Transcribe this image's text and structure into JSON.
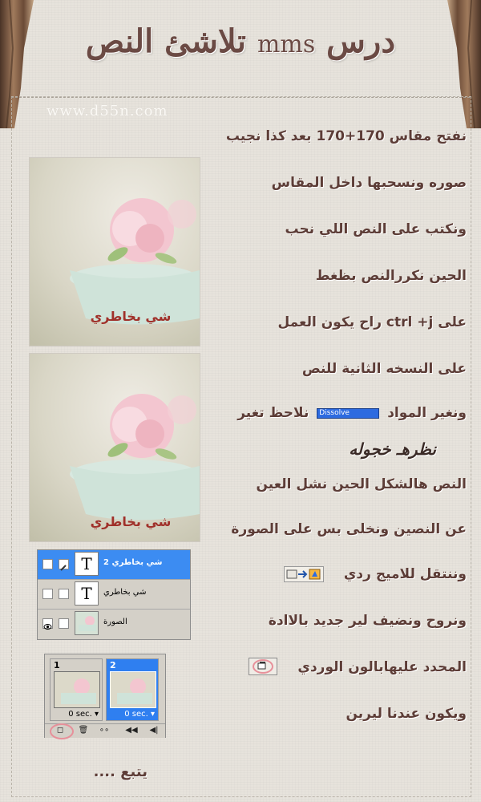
{
  "page": {
    "title_part1": "درس",
    "title_latin": "mms",
    "title_part2": "تلاشئ النص",
    "watermark": "www.d55n.com",
    "footer": "يتبع ...."
  },
  "lines": [
    {
      "text": "نفتح مقاس  170+170 بعد كذا نجيب"
    },
    {
      "text": "صوره ونسحبها داخل المقاس"
    },
    {
      "text": "ونكتب على النص اللي نحب"
    },
    {
      "text": "الحين نكررالنص بظغط"
    },
    {
      "text": "على ctrl +j راح يكون العمل"
    },
    {
      "text": "على النسخه الثانية للنص"
    },
    {
      "text_before": "ونغير المواد",
      "tag": "Dissolve",
      "text_after": "نلاحظ تغير"
    },
    {
      "text": "نظرهـ خجوله"
    },
    {
      "text": "النص هالشكل الحين نشل العين"
    },
    {
      "text": "عن النصين ونخلى بس على الصورة"
    },
    {
      "text": "وننتقل للاميج ردي"
    },
    {
      "text": "ونروح ونضيف لير جديد بالاادة"
    },
    {
      "text": "المحدد عليهابالون الوردي"
    },
    {
      "text": "ويكون عندنا ليرين"
    }
  ],
  "photos": [
    {
      "caption": "شي بخاطري"
    },
    {
      "caption": "شي بخاطري"
    }
  ],
  "layers_panel": {
    "rows": [
      {
        "name": "شي بخاطري 2",
        "type": "text",
        "thumb_glyph": "T",
        "selected": true
      },
      {
        "name": "شي بخاطري",
        "type": "text",
        "thumb_glyph": "T",
        "selected": false
      },
      {
        "name": "الصورة",
        "type": "image",
        "thumb_glyph": "",
        "selected": false
      }
    ]
  },
  "animation_panel": {
    "frames": [
      {
        "num": "1",
        "delay": "0 sec.",
        "selected": false
      },
      {
        "num": "2",
        "delay": "0 sec.",
        "selected": true
      }
    ]
  },
  "colors": {
    "body_text": "#5d3d37",
    "caption": "#a0302a",
    "selection_blue": "#3c8cf2",
    "highlight_ring": "#e7909a"
  }
}
